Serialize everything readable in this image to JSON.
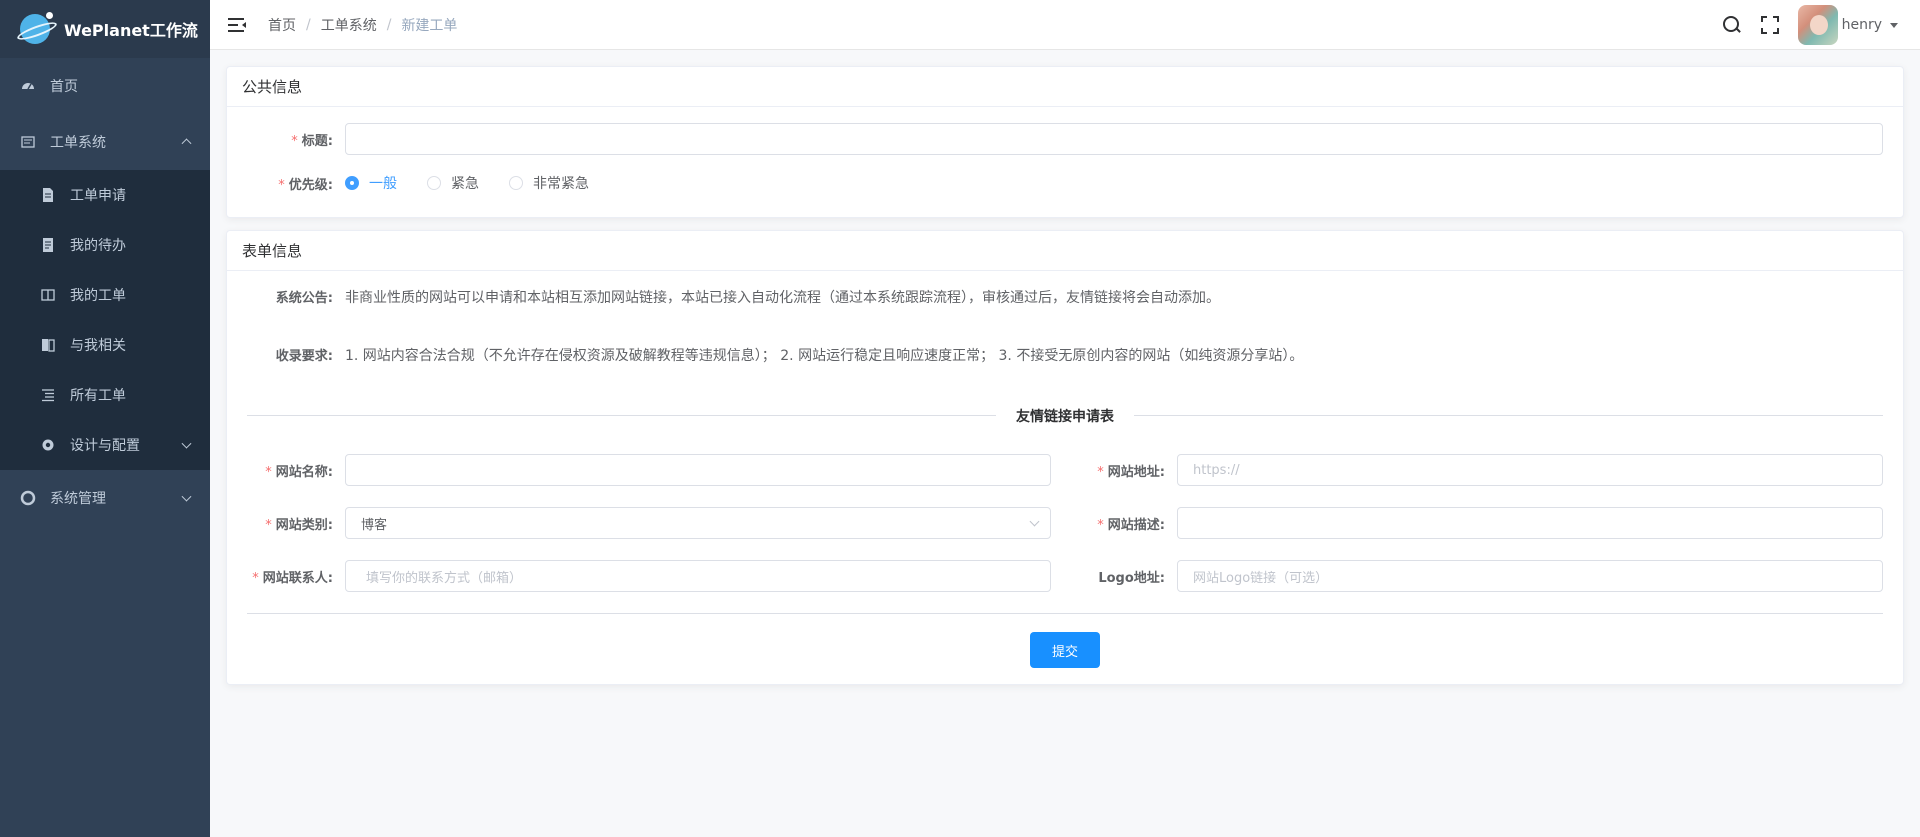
{
  "app": {
    "title": "WePlanet工作流"
  },
  "sidebar": {
    "home": "首页",
    "workorder_system": "工单系统",
    "sub_items": [
      {
        "label": "工单申请",
        "icon": "doc-icon"
      },
      {
        "label": "我的待办",
        "icon": "todo-icon"
      },
      {
        "label": "我的工单",
        "icon": "book-icon"
      },
      {
        "label": "与我相关",
        "icon": "related-icon"
      },
      {
        "label": "所有工单",
        "icon": "list-icon"
      },
      {
        "label": "设计与配置",
        "icon": "gear-icon"
      }
    ],
    "system_manage": "系统管理"
  },
  "header": {
    "breadcrumb": [
      "首页",
      "工单系统",
      "新建工单"
    ],
    "separator": "/",
    "username": "henry"
  },
  "public_info": {
    "title": "公共信息",
    "title_label": "标题:",
    "title_value": "",
    "priority_label": "优先级:",
    "priority_options": [
      "一般",
      "紧急",
      "非常紧急"
    ],
    "priority_selected": "一般"
  },
  "form_info": {
    "title": "表单信息",
    "notice_label": "系统公告:",
    "notice_text": "非商业性质的网站可以申请和本站相互添加网站链接，本站已接入自动化流程（通过本系统跟踪流程），审核通过后，友情链接将会自动添加。",
    "requirement_label": "收录要求:",
    "requirement_text": "1. 网站内容合法合规（不允许存在侵权资源及破解教程等违规信息）； 2. 网站运行稳定且响应速度正常； 3. 不接受无原创内容的网站（如纯资源分享站）。",
    "divider_text": "友情链接申请表",
    "fields": {
      "site_name_label": "网站名称:",
      "site_name_value": "",
      "site_url_label": "网站地址:",
      "site_url_placeholder": "https://",
      "site_category_label": "网站类别:",
      "site_category_value": "博客",
      "site_desc_label": "网站描述:",
      "site_desc_value": "",
      "site_contact_label": "网站联系人:",
      "site_contact_placeholder": "填写你的联系方式（邮箱）",
      "logo_label": "Logo地址:",
      "logo_placeholder": "网站Logo链接（可选）"
    },
    "required_mark": "*",
    "submit_label": "提交"
  },
  "colors": {
    "sidebar_bg": "#304156",
    "submenu_bg": "#1f2d3d",
    "primary": "#1890ff",
    "radio_active": "#409eff",
    "required": "#f56c6c"
  }
}
